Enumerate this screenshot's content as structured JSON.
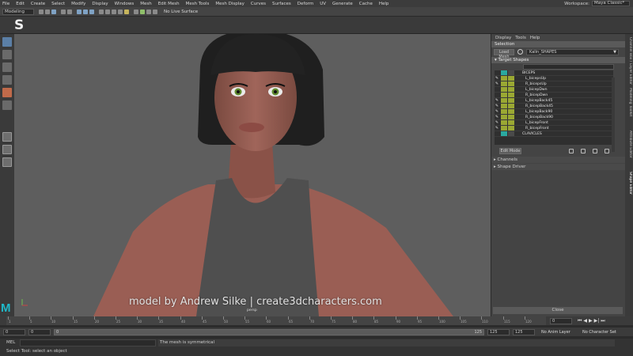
{
  "menubar": {
    "items": [
      "File",
      "Edit",
      "Create",
      "Select",
      "Modify",
      "Display",
      "Windows",
      "Mesh",
      "Edit Mesh",
      "Mesh Tools",
      "Mesh Display",
      "Curves",
      "Surfaces",
      "Deform",
      "UV",
      "Generate",
      "Cache",
      "Help"
    ],
    "workspace_label": "Workspace:",
    "workspace_value": "Maya Classic*"
  },
  "statusline": {
    "menuset": "Modeling",
    "live_surface": "No Live Surface"
  },
  "shelf": {
    "logo_letter": "S"
  },
  "viewport": {
    "watermark": "model by Andrew Silke | create3dcharacters.com",
    "camera_name": "persp"
  },
  "app_logo": "M",
  "shape_editor": {
    "menus": [
      "Display",
      "Tools",
      "Help"
    ],
    "selection_header": "Selection",
    "load_mesh_label": "Load Mesh",
    "mesh_name": "Kalin_SHAPES",
    "target_shapes_header": "Target Shapes",
    "shapes": [
      {
        "name": "BICEPS",
        "group": true,
        "pen": false,
        "color": "#2aa9a0"
      },
      {
        "name": "L_bicepsUp",
        "group": false,
        "pen": true,
        "color": "#9aa833"
      },
      {
        "name": "R_bicepsUp",
        "group": false,
        "pen": true,
        "color": "#9aa833"
      },
      {
        "name": "L_bicepDwn",
        "group": false,
        "pen": false,
        "color": "#9aa833"
      },
      {
        "name": "R_bicepDwn",
        "group": false,
        "pen": false,
        "color": "#9aa833"
      },
      {
        "name": "L_bicepBack45",
        "group": false,
        "pen": true,
        "color": "#9aa833"
      },
      {
        "name": "R_bicepBack45",
        "group": false,
        "pen": true,
        "color": "#9aa833"
      },
      {
        "name": "L_bicepBack90",
        "group": false,
        "pen": true,
        "color": "#9aa833"
      },
      {
        "name": "R_bicepBack90",
        "group": false,
        "pen": true,
        "color": "#9aa833"
      },
      {
        "name": "L_bicepFront",
        "group": false,
        "pen": true,
        "color": "#9aa833"
      },
      {
        "name": "R_bicepFront",
        "group": false,
        "pen": true,
        "color": "#9aa833"
      },
      {
        "name": "CLAVICLES",
        "group": true,
        "pen": false,
        "color": "#2aa9a0"
      }
    ],
    "edit_mode_label": "Edit Mode",
    "channels_header": "Channels",
    "shape_driver_header": "Shape Driver",
    "close_label": "Close"
  },
  "side_tabs": [
    "Channel Box / Layer Editor",
    "Modeling Toolkit",
    "Attribute Editor",
    "Shape Editor"
  ],
  "timeline": {
    "tick_labels": [
      "1",
      "5",
      "10",
      "15",
      "20",
      "25",
      "30",
      "35",
      "40",
      "45",
      "50",
      "55",
      "60",
      "65",
      "70",
      "75",
      "80",
      "85",
      "90",
      "95",
      "100",
      "105",
      "110",
      "115",
      "120"
    ],
    "current_frame": "0"
  },
  "range": {
    "start": "0",
    "inner_start": "0",
    "bar_left": "0",
    "bar_right": "125",
    "end_a": "125",
    "end_b": "125",
    "anim_layer": "No Anim Layer",
    "character_set": "No Character Set"
  },
  "command_line": {
    "language": "MEL",
    "result": "The mesh is symmetrical"
  },
  "help_line": "Select Tool: select an object"
}
